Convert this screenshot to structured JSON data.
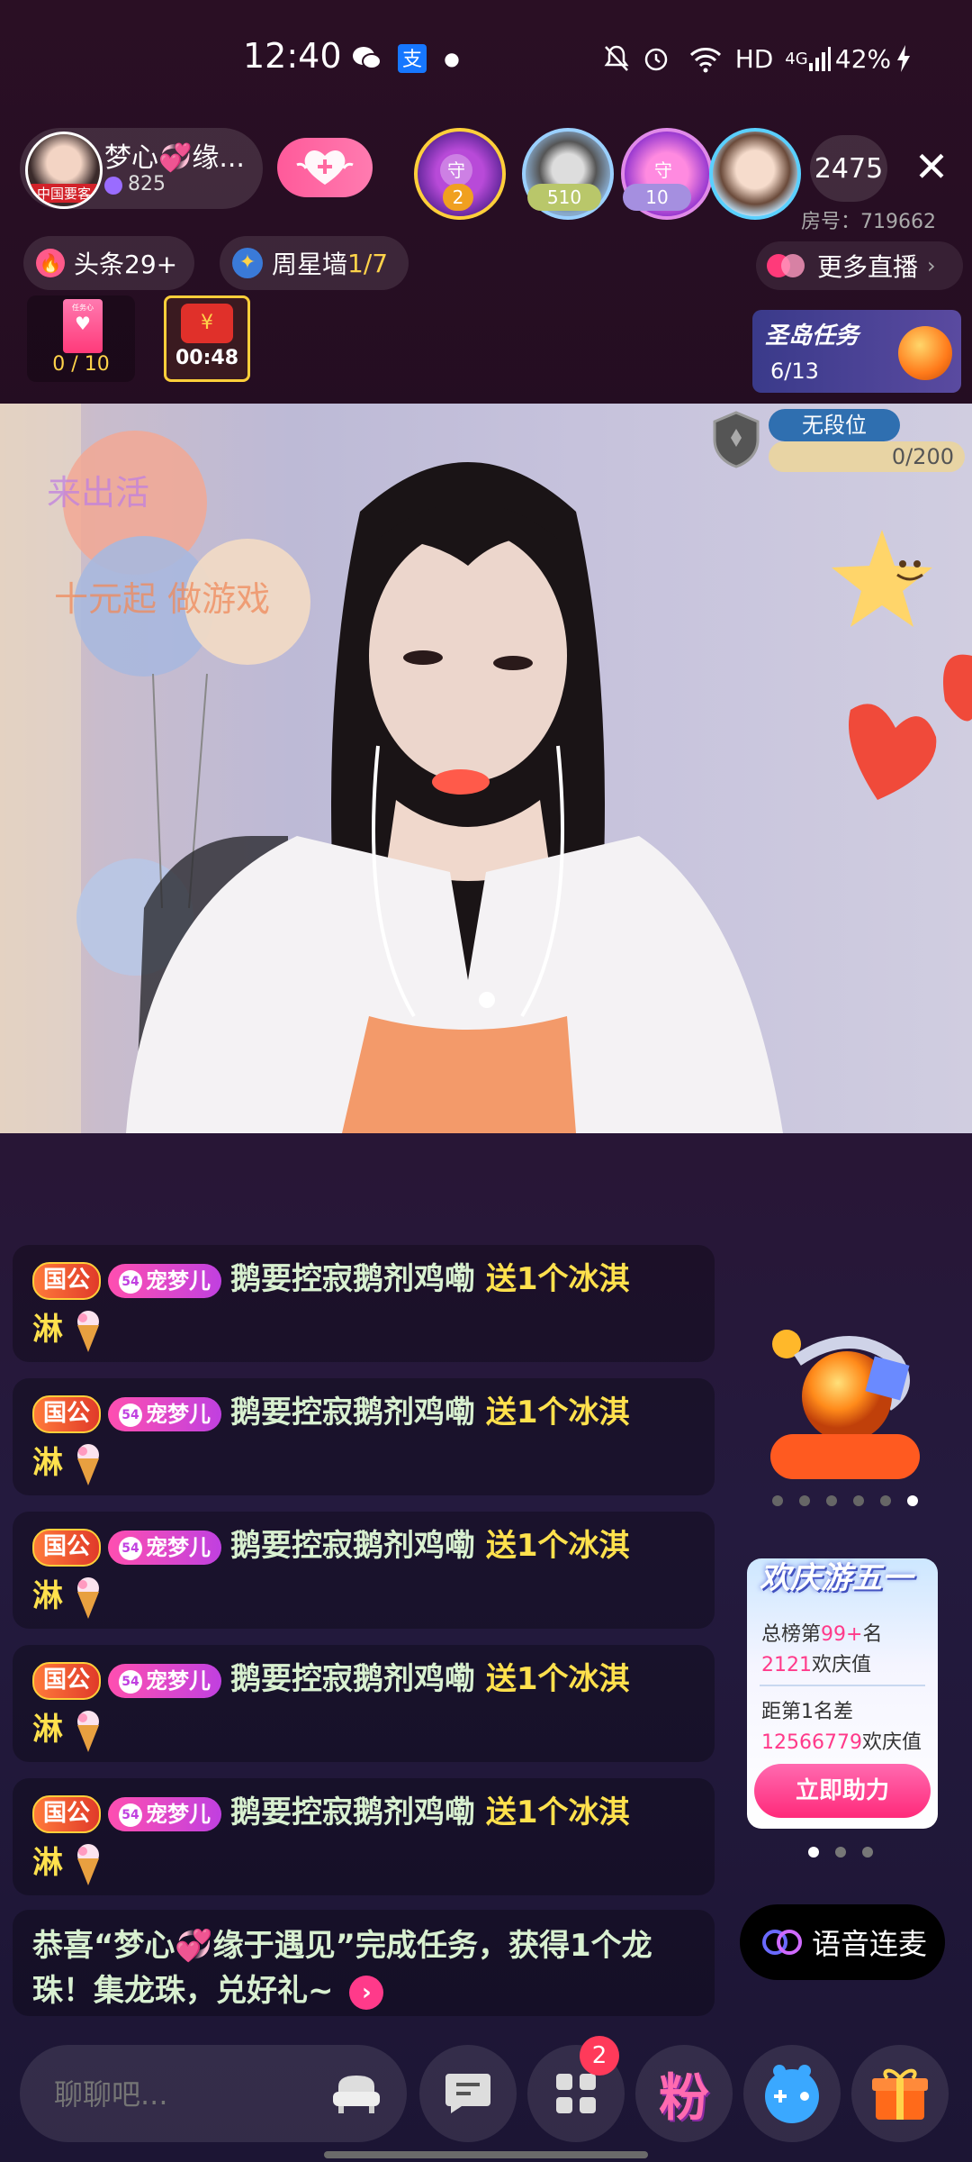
{
  "status_bar": {
    "time": "12:40",
    "network": "HD",
    "signal": "4G",
    "battery": "42%"
  },
  "host": {
    "name": "梦心💞缘...",
    "fans": "825",
    "avatar_tag": "中国要客"
  },
  "top_viewers": [
    {
      "badge": "2",
      "color": "#f0a020"
    },
    {
      "badge": "510",
      "color": "#b9c76a"
    },
    {
      "badge": "10",
      "color": "#a58fe0"
    }
  ],
  "viewer_count": "2475",
  "room_id": "房号：719662",
  "tags": {
    "headline": "头条29+",
    "week_star_prefix": "周星墙",
    "week_star_value": "1/7",
    "more_live": "更多直播"
  },
  "gift_task": {
    "progress": "0 / 10",
    "title": "任务心"
  },
  "red_packet": {
    "timer": "00:48",
    "symbol": "¥"
  },
  "island_task": {
    "title": "圣岛任务",
    "progress": "6/13"
  },
  "rank": {
    "label": "无段位",
    "progress": "0/200",
    "progress_fraction": 0.0
  },
  "video_overlay": {
    "line1": "来出活",
    "line2": "十元起 做游戏"
  },
  "chat": [
    {
      "badge": "国公",
      "pet_level": "54",
      "pet_name": "宠梦儿",
      "user": "鹅要控寂鹅剂鸡嘞",
      "gift": "送1个冰淇",
      "gift_tail": "淋"
    },
    {
      "badge": "国公",
      "pet_level": "54",
      "pet_name": "宠梦儿",
      "user": "鹅要控寂鹅剂鸡嘞",
      "gift": "送1个冰淇",
      "gift_tail": "淋"
    },
    {
      "badge": "国公",
      "pet_level": "54",
      "pet_name": "宠梦儿",
      "user": "鹅要控寂鹅剂鸡嘞",
      "gift": "送1个冰淇",
      "gift_tail": "淋"
    },
    {
      "badge": "国公",
      "pet_level": "54",
      "pet_name": "宠梦儿",
      "user": "鹅要控寂鹅剂鸡嘞",
      "gift": "送1个冰淇",
      "gift_tail": "淋"
    },
    {
      "badge": "国公",
      "pet_level": "54",
      "pet_name": "宠梦儿",
      "user": "鹅要控寂鹅剂鸡嘞",
      "gift": "送1个冰淇",
      "gift_tail": "淋"
    }
  ],
  "system_msg": {
    "line1": "恭喜“梦心💞缘于遇见”完成任务，获得1个龙",
    "line2": "珠！集龙珠，兑好礼~"
  },
  "event_card": {
    "title": "欢庆游五一",
    "rank_prefix": "总榜第",
    "rank_value": "99+",
    "rank_suffix": "名",
    "score_value": "2121",
    "score_suffix": "欢庆值",
    "gap_label": "距第1名差",
    "gap_value": "12566779",
    "gap_suffix": "欢庆值",
    "button": "立即助力"
  },
  "voice_btn": "语音连麦",
  "chat_input": {
    "placeholder": "聊聊吧..."
  },
  "bottom_bar": {
    "grid_badge": "2",
    "fans_label": "粉"
  }
}
